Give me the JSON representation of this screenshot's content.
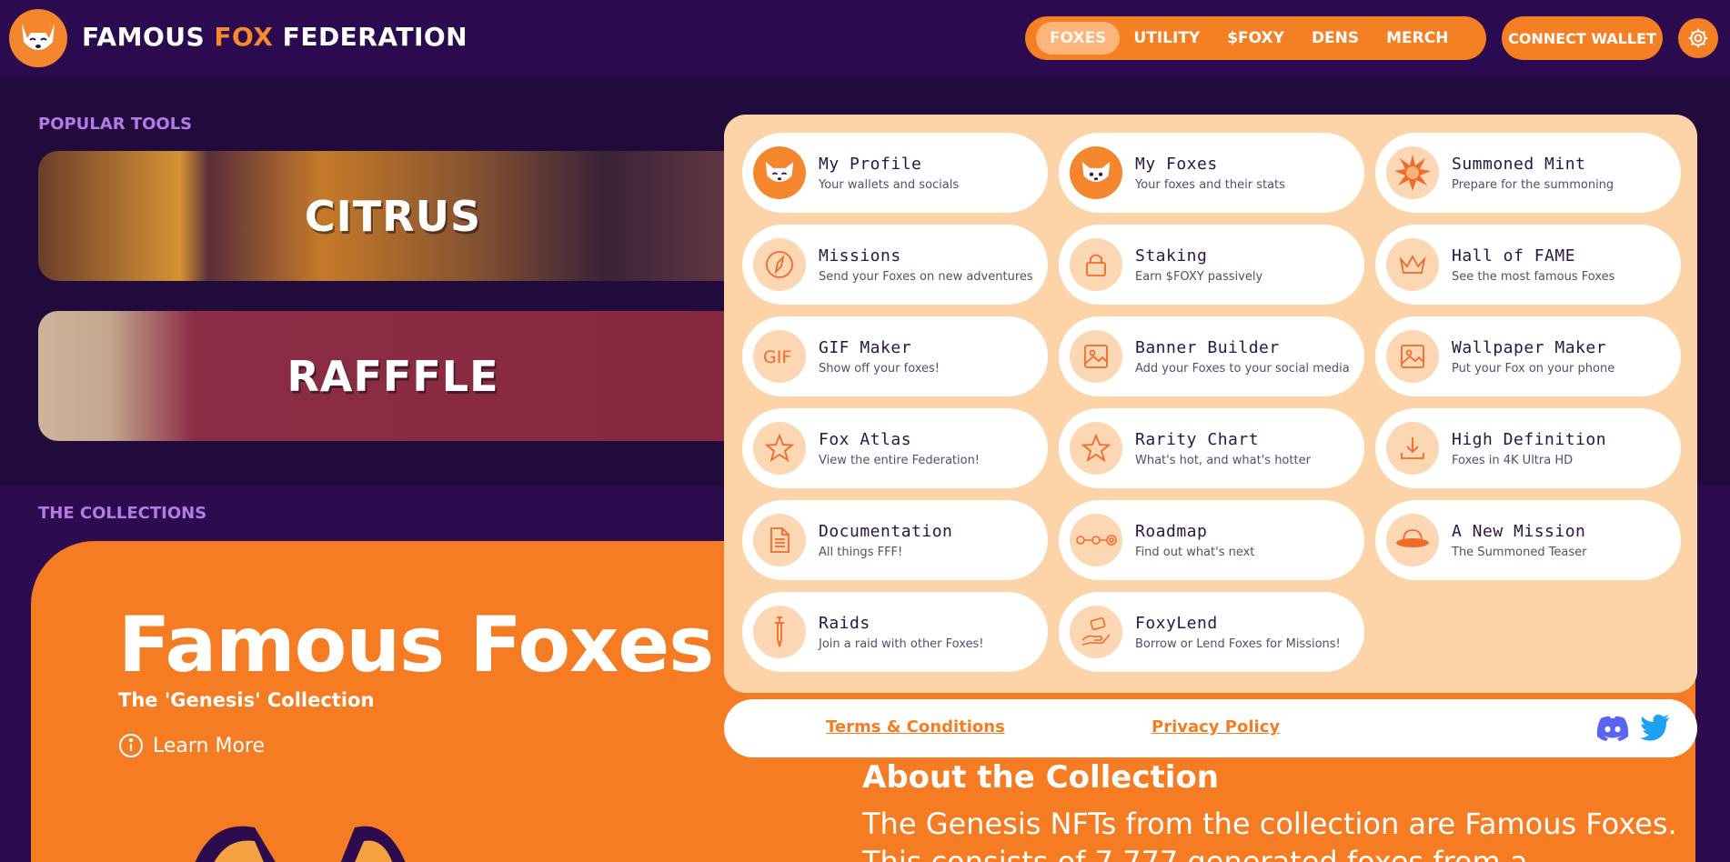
{
  "header": {
    "brand_part1": "FAMOUS ",
    "brand_part2": "FOX",
    "brand_part3": " FEDERATION",
    "nav": [
      "FOXES",
      "UTILITY",
      "$FOXY",
      "DENS",
      "MERCH"
    ],
    "active_nav": "FOXES",
    "connect_label": "CONNECT WALLET"
  },
  "popular_tools": {
    "label": "POPULAR TOOLS",
    "cards": [
      "CITRUS",
      "RAFFFLE"
    ]
  },
  "collections": {
    "label": "THE COLLECTIONS",
    "title": "Famous Foxes",
    "subtitle": "The 'Genesis' Collection",
    "learn_more": "Learn More",
    "about_title": "About the Collection",
    "about_body": "The Genesis NFTs from the collection are Famous Foxes. This consists of 7,777 generated foxes from a"
  },
  "menu": {
    "items": [
      {
        "title": "My Profile",
        "desc": "Your wallets and socials",
        "icon": "fox-avatar-icon"
      },
      {
        "title": "My Foxes",
        "desc": "Your foxes and their stats",
        "icon": "fox-avatar-icon"
      },
      {
        "title": "Summoned Mint",
        "desc": "Prepare for the summoning",
        "icon": "summoned-burst-icon"
      },
      {
        "title": "Missions",
        "desc": "Send your Foxes on new adventures",
        "icon": "compass-icon"
      },
      {
        "title": "Staking",
        "desc": "Earn $FOXY passively",
        "icon": "lock-icon"
      },
      {
        "title": "Hall of FAME",
        "desc": "See the most famous Foxes",
        "icon": "crown-icon"
      },
      {
        "title": "GIF Maker",
        "desc": "Show off your foxes!",
        "icon": "gif-icon"
      },
      {
        "title": "Banner Builder",
        "desc": "Add your Foxes to your social media",
        "icon": "image-icon"
      },
      {
        "title": "Wallpaper Maker",
        "desc": "Put your Fox on your phone",
        "icon": "image-icon"
      },
      {
        "title": "Fox Atlas",
        "desc": "View the entire Federation!",
        "icon": "star-icon"
      },
      {
        "title": "Rarity Chart",
        "desc": "What's hot, and what's hotter",
        "icon": "star-icon"
      },
      {
        "title": "High Definition",
        "desc": "Foxes in 4K Ultra HD",
        "icon": "download-icon"
      },
      {
        "title": "Documentation",
        "desc": "All things FFF!",
        "icon": "document-icon"
      },
      {
        "title": "Roadmap",
        "desc": "Find out what's next",
        "icon": "roadmap-icon"
      },
      {
        "title": "A New Mission",
        "desc": "The Summoned Teaser",
        "icon": "ufo-icon"
      },
      {
        "title": "Raids",
        "desc": "Join a raid with other Foxes!",
        "icon": "dagger-icon"
      },
      {
        "title": "FoxyLend",
        "desc": "Borrow or Lend Foxes for Missions!",
        "icon": "lend-hand-icon"
      }
    ],
    "terms": "Terms & Conditions",
    "privacy": "Privacy Policy"
  },
  "colors": {
    "background": "#2c0c4e",
    "orange": "#f57c22",
    "menu_bg": "#fdd4a7",
    "accent_purple": "#b57ae8"
  }
}
